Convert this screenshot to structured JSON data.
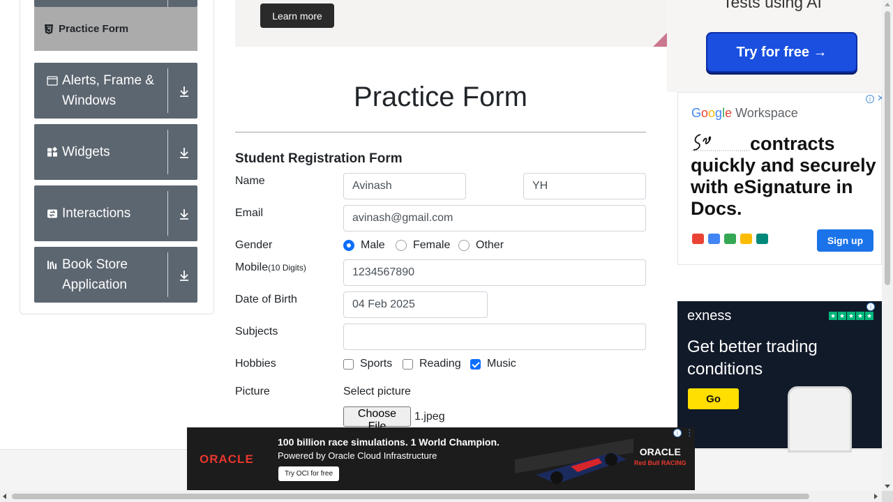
{
  "sidebar": {
    "active_item": "Practice Form",
    "groups": [
      {
        "label": "Alerts, Frame & Windows",
        "icon": "window-icon"
      },
      {
        "label": "Widgets",
        "icon": "widgets-icon"
      },
      {
        "label": "Interactions",
        "icon": "interactions-icon"
      },
      {
        "label": "Book Store Application",
        "icon": "library-icon"
      }
    ]
  },
  "banner": {
    "learn_more": "Learn more"
  },
  "page": {
    "title": "Practice Form"
  },
  "form": {
    "heading": "Student Registration Form",
    "name": {
      "label": "Name",
      "first": "Avinash",
      "last": "YH"
    },
    "email": {
      "label": "Email",
      "value": "avinash@gmail.com"
    },
    "gender": {
      "label": "Gender",
      "options": [
        "Male",
        "Female",
        "Other"
      ],
      "selected": "Male"
    },
    "mobile": {
      "label": "Mobile",
      "hint": "(10 Digits)",
      "value": "1234567890"
    },
    "dob": {
      "label": "Date of Birth",
      "value": "04 Feb 2025"
    },
    "subjects": {
      "label": "Subjects",
      "value": ""
    },
    "hobbies": {
      "label": "Hobbies",
      "options": [
        "Sports",
        "Reading",
        "Music"
      ],
      "checked": [
        "Music"
      ]
    },
    "picture": {
      "label": "Picture",
      "select_label": "Select picture",
      "button": "Choose File",
      "file": "1.jpeg"
    }
  },
  "ads": {
    "top": {
      "text": "Tests using AI",
      "button": "Try for free →"
    },
    "workspace": {
      "brand": [
        "G",
        "o",
        "o",
        "g",
        "l",
        "e"
      ],
      "product": "Workspace",
      "headline": "contracts quickly and securely with eSignature in Docs.",
      "button": "Sign up"
    },
    "exness": {
      "brand": "exness",
      "headline": "Get better trading conditions",
      "button": "Go"
    },
    "oracle": {
      "brand": "ORACLE",
      "line1": "100 billion race simulations. 1 World Champion.",
      "line2": "Powered by Oracle Cloud Infrastructure",
      "button": "Try OCI for free",
      "partner_top": "ORACLE",
      "partner_bottom": "Red Bull RACING"
    }
  },
  "colors": {
    "primary": "#0d6efd",
    "sidebar": "#5c6670",
    "active": "#ababab"
  }
}
